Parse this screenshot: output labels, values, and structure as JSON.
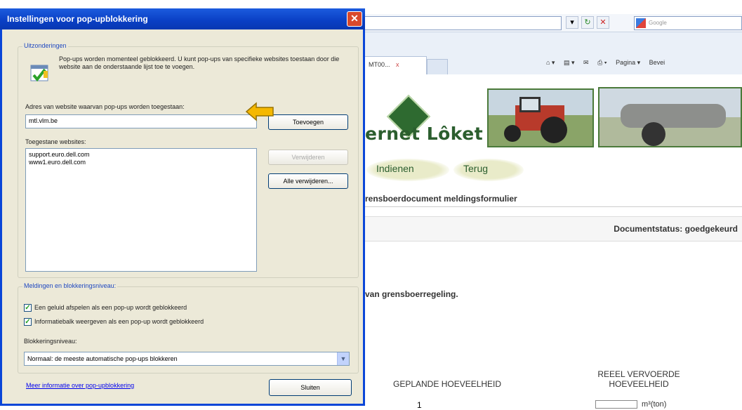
{
  "browser": {
    "search_placeholder": "Google",
    "tab_label": "MT00...",
    "tab_close": "x",
    "tools": [
      "Pagina ▾",
      "Bevei"
    ],
    "addr_icons": [
      "▾",
      "↻",
      "✕"
    ]
  },
  "page": {
    "brand": "ernet Lôket",
    "nav": [
      "Indienen",
      "Terug"
    ],
    "form_title": "rensboerdocument meldingsformulier",
    "doc_status": "Documentstatus: goedgekeurd",
    "message": "van grensboerregeling.",
    "col_planned": "GEPLANDE HOEVEELHEID",
    "col_real": "REEEL VERVOERDE HOEVEELHEID",
    "row_value": "1",
    "unit": "m³(ton)"
  },
  "dialog": {
    "title": "Instellingen voor pop-upblokkering",
    "close_glyph": "✕",
    "group1_legend": "Uitzonderingen",
    "info_text": "Pop-ups worden momenteel geblokkeerd. U kunt pop-ups van specifieke websites toestaan door die website aan de onderstaande lijst toe te voegen.",
    "addr_label": "Adres van website waarvan pop-ups worden toegestaan:",
    "addr_value": "mtl.vlm.be",
    "add_button": "Toevoegen",
    "allowed_label": "Toegestane websites:",
    "allowed_sites": [
      "support.euro.dell.com",
      "www1.euro.dell.com"
    ],
    "remove_button": "Verwijderen",
    "remove_all_button": "Alle verwijderen...",
    "group2_legend": "Meldingen en blokkeringsniveau:",
    "chk_sound": "Een geluid afspelen als een pop-up wordt geblokkeerd",
    "chk_infobar": "Informatiebalk weergeven als een pop-up wordt geblokkeerd",
    "level_label": "Blokkeringsniveau:",
    "level_value": "Normaal: de meeste automatische pop-ups blokkeren",
    "more_info": "Meer informatie over pop-upblokkering",
    "close_button": "Sluiten"
  },
  "colors": {
    "titlebar": "#0a3fc4",
    "dialog_bg": "#ece9d8",
    "arrow": "#f5b800"
  }
}
